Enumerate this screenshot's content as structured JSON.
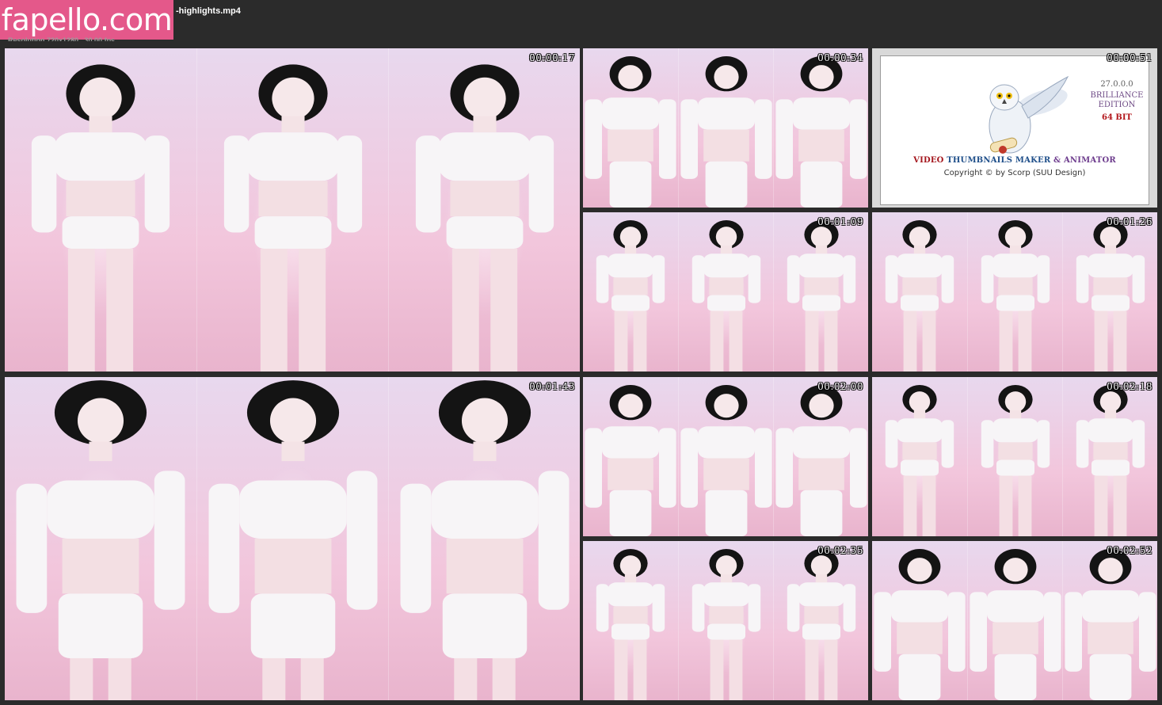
{
  "header": {
    "logo_text": "fapello.com",
    "filename": "-highlights.mp4",
    "meta_line": "Resolution 720x1280 , 30.00 fps"
  },
  "colors": {
    "page_bg": "#2b2b2b",
    "logo_bg": "#e4588a",
    "panel_pink": "#f3c7dc",
    "panel_lavender": "#ead6ec",
    "outfit_white": "#f7f5f7",
    "hair_black": "#141414"
  },
  "thumbnails": [
    {
      "time": "00:00:17"
    },
    {
      "time": "00:00:34"
    },
    {
      "time": "00:00:51"
    },
    {
      "time": "00:01:09"
    },
    {
      "time": "00:01:26"
    },
    {
      "time": "00:01:43"
    },
    {
      "time": "00:02:00"
    },
    {
      "time": "00:02:18"
    },
    {
      "time": "00:02:35"
    },
    {
      "time": "00:02:52"
    }
  ],
  "splash": {
    "version": "27.0.0.0",
    "edition_line1": "BRILLIANCE",
    "edition_line2": "EDITION",
    "bits": "64 BIT",
    "title_word1": "VIDEO",
    "title_word2": "THUMBNAILS MAKER",
    "title_word3": "& ANIMATOR",
    "copyright": "Copyright © by Scorp (SUU Design)",
    "icon": "owl-icon"
  }
}
